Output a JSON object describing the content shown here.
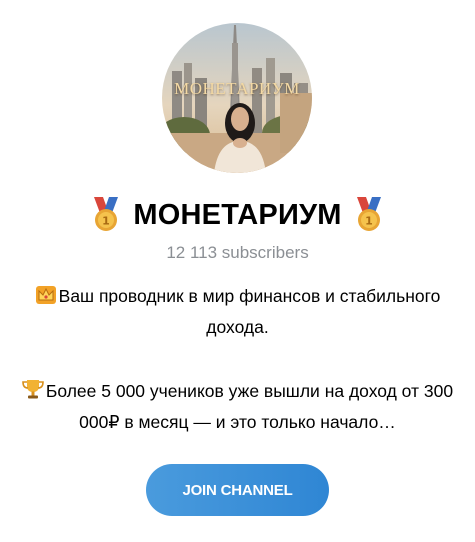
{
  "channel": {
    "avatar_caption": "МОНЕТАРИУМ",
    "title": "МОНЕТАРИУМ",
    "title_emoji": "medal-icon",
    "subscribers": "12 113 subscribers"
  },
  "description": {
    "line1_icon": "crown-icon",
    "line1": "Ваш проводник в мир финансов и стабильного дохода.",
    "line2_icon": "trophy-icon",
    "line2": "Более 5 000 учеников уже вышли на доход от 300 000₽ в месяц — и это только начало…"
  },
  "actions": {
    "join_label": "JOIN CHANNEL"
  },
  "colors": {
    "accent": "#3a8fd8",
    "subtle_text": "#8b8f94"
  }
}
